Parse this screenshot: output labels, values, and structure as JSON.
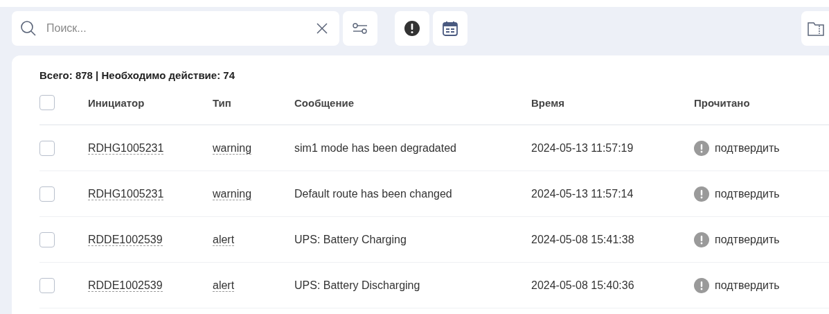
{
  "search": {
    "placeholder": "Поиск..."
  },
  "summary": "**Всего: 878** | **Необходимо действие: 74**",
  "table": {
    "columns": [
      "Инициатор",
      "Тип",
      "Сообщение",
      "Время",
      "Прочитано"
    ],
    "select_all_checked": false,
    "rows": [
      {
        "checked": false,
        "initiator": "RDHG1005231",
        "type": "warning",
        "message": "sim1 mode has been degradated",
        "time": "2024-05-13 11:57:19",
        "read_action": "подтвердить"
      },
      {
        "checked": false,
        "initiator": "RDHG1005231",
        "type": "warning",
        "message": "Default route has been changed",
        "time": "2024-05-13 11:57:14",
        "read_action": "подтвердить"
      },
      {
        "checked": false,
        "initiator": "RDDE1002539",
        "type": "alert",
        "message": "UPS: Battery Charging",
        "time": "2024-05-08 15:41:38",
        "read_action": "подтвердить"
      },
      {
        "checked": false,
        "initiator": "RDDE1002539",
        "type": "alert",
        "message": "UPS: Battery Discharging",
        "time": "2024-05-08 15:40:36",
        "read_action": "подтвердить"
      }
    ]
  }
}
